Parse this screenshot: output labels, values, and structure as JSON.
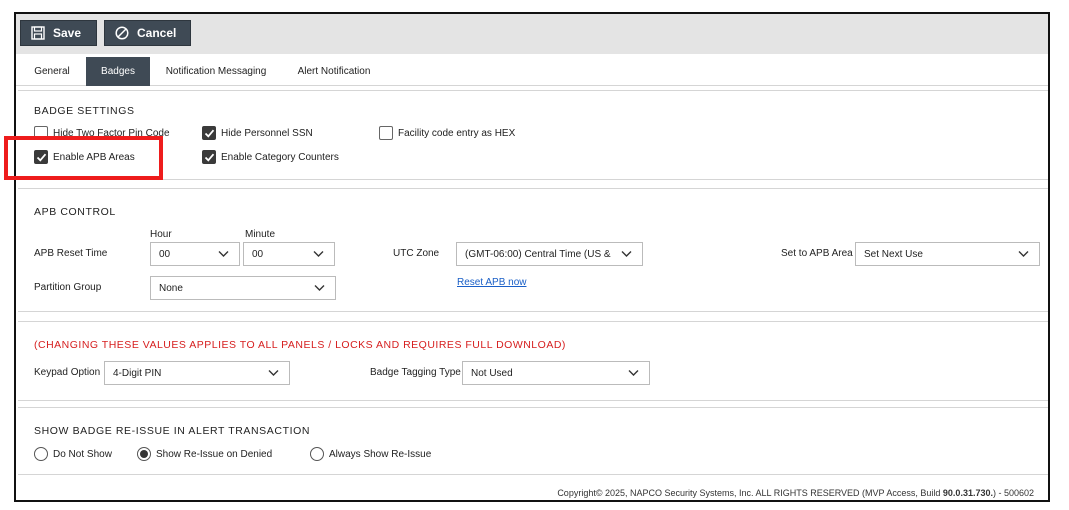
{
  "toolbar": {
    "save_label": "Save",
    "cancel_label": "Cancel"
  },
  "tabs": [
    {
      "label": "General",
      "active": false
    },
    {
      "label": "Badges",
      "active": true
    },
    {
      "label": "Notification Messaging",
      "active": false
    },
    {
      "label": "Alert Notification",
      "active": false
    }
  ],
  "badge_settings": {
    "title": "BADGE SETTINGS",
    "options": [
      {
        "label": "Hide Two Factor Pin Code",
        "checked": false
      },
      {
        "label": "Hide Personnel SSN",
        "checked": true
      },
      {
        "label": "Facility code entry as HEX",
        "checked": false
      },
      {
        "label": "Enable APB Areas",
        "checked": true
      },
      {
        "label": "Enable Category Counters",
        "checked": true
      }
    ]
  },
  "apb_control": {
    "title": "APB CONTROL",
    "hour_label": "Hour",
    "minute_label": "Minute",
    "reset_time_label": "APB Reset Time",
    "hour_value": "00",
    "minute_value": "00",
    "utc_label": "UTC Zone",
    "utc_value": "(GMT-06:00) Central Time (US &",
    "set_area_label": "Set to APB Area",
    "set_area_value": "Set Next Use",
    "partition_label": "Partition Group",
    "partition_value": "None",
    "reset_link": "Reset APB now"
  },
  "download_warning": {
    "title": "(CHANGING THESE VALUES APPLIES TO ALL PANELS / LOCKS AND REQUIRES FULL DOWNLOAD)",
    "keypad_label": "Keypad Option",
    "keypad_value": "4-Digit PIN",
    "tagging_label": "Badge Tagging Type",
    "tagging_value": "Not Used"
  },
  "reissue": {
    "title": "SHOW BADGE RE-ISSUE IN ALERT TRANSACTION",
    "options": [
      {
        "label": "Do Not Show",
        "selected": false
      },
      {
        "label": "Show Re-Issue on Denied",
        "selected": true
      },
      {
        "label": "Always Show Re-Issue",
        "selected": false
      }
    ]
  },
  "footer": {
    "text": "Copyright© 2025, NAPCO Security Systems, Inc. ALL RIGHTS RESERVED (MVP Access, Build ",
    "build": "90.0.31.730.",
    "suffix": ") - 500602"
  },
  "colors": {
    "toolbar_button": "#3f4a55",
    "highlight": "#ee1c1c",
    "warning": "#d61e1e",
    "link": "#1a5fc7"
  }
}
